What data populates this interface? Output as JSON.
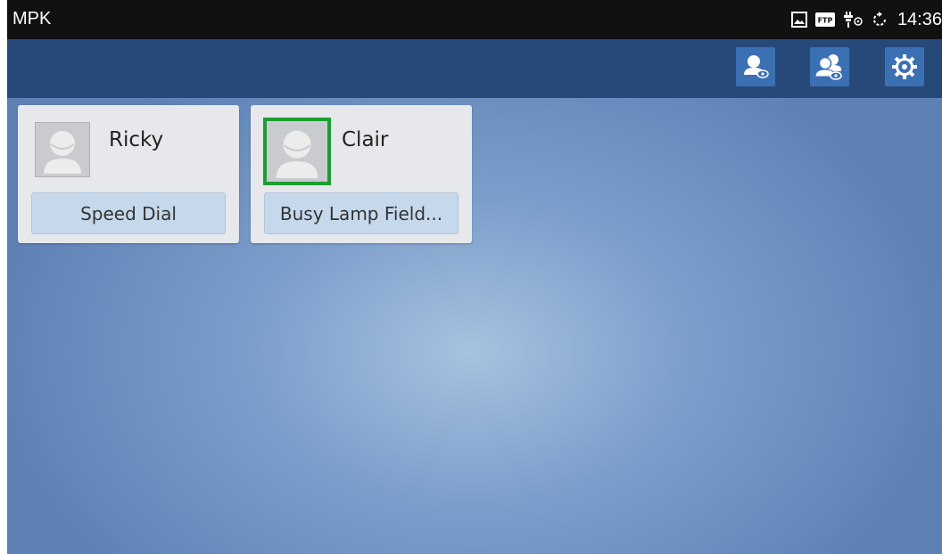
{
  "statusbar": {
    "app_title": "MPK",
    "clock": "14:36",
    "icons": [
      "image-icon",
      "ftp-icon",
      "usb-debug-icon",
      "sync-icon"
    ],
    "ftp_label": "FTP"
  },
  "actionbar": {
    "buttons": [
      "contact-view-icon",
      "group-view-icon",
      "settings-gear-icon"
    ],
    "button_color": "#3b70b3",
    "bar_color": "#27497a"
  },
  "cards": [
    {
      "name": "Ricky",
      "mode": "Speed Dial",
      "avatar_highlighted": false
    },
    {
      "name": "Clair",
      "mode": "Busy Lamp Field...",
      "avatar_highlighted": true,
      "highlight_color": "#1d9e33"
    }
  ]
}
